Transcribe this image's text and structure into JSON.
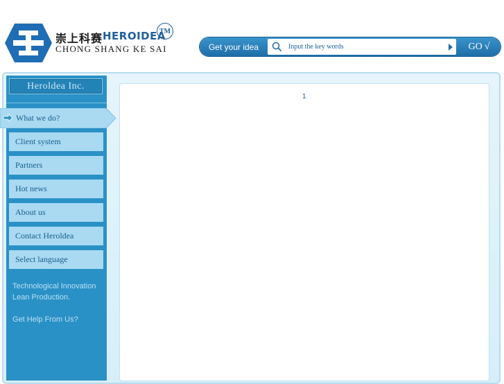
{
  "header": {
    "logo_cn": "崇上科赛",
    "logo_en": "HEROIDEA",
    "logo_sub": "CHONG SHANG KE SAI",
    "trademark": "TM"
  },
  "search": {
    "label": "Get your idea",
    "placeholder": "Input the key words",
    "go_label": "GO",
    "go_check": "√"
  },
  "sidebar": {
    "company": "Heroldea Inc.",
    "active_item": "What we do?",
    "items": [
      {
        "label": "Client system"
      },
      {
        "label": "Partners"
      },
      {
        "label": "Hot news"
      },
      {
        "label": "About us"
      },
      {
        "label": "Contact Heroldea"
      },
      {
        "label": "Select language"
      }
    ],
    "tagline_1": "Technological Innovation",
    "tagline_2": "Lean Production.",
    "help": "Get Help From Us?"
  },
  "content": {
    "page_number": "1"
  },
  "colors": {
    "brand_blue": "#1f5f9c",
    "sidebar": "#2a91c6",
    "nav_item": "#a9daf2"
  }
}
